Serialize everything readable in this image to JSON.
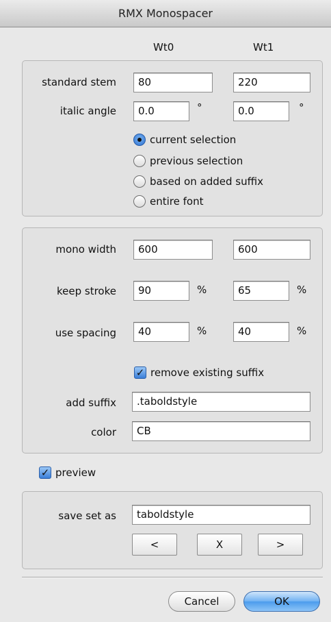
{
  "window": {
    "title": "RMX Monospacer"
  },
  "columns": {
    "wt0": "Wt0",
    "wt1": "Wt1"
  },
  "stem_group": {
    "standard_stem": {
      "label": "standard stem",
      "wt0": "80",
      "wt1": "220"
    },
    "italic_angle": {
      "label": "italic angle",
      "wt0": "0.0",
      "wt1": "0.0",
      "unit": "°"
    },
    "scope_options": [
      {
        "label": "current selection",
        "selected": true
      },
      {
        "label": "previous selection",
        "selected": false
      },
      {
        "label": "based on added suffix",
        "selected": false
      },
      {
        "label": "entire font",
        "selected": false
      }
    ]
  },
  "width_group": {
    "mono_width": {
      "label": "mono width",
      "wt0": "600",
      "wt1": "600"
    },
    "keep_stroke": {
      "label": "keep stroke",
      "wt0": "90",
      "wt1": "65",
      "unit": "%"
    },
    "use_spacing": {
      "label": "use spacing",
      "wt0": "40",
      "wt1": "40",
      "unit": "%"
    },
    "remove_suffix": {
      "label": "remove existing suffix",
      "checked": true
    },
    "add_suffix": {
      "label": "add suffix",
      "value": ".taboldstyle"
    },
    "color": {
      "label": "color",
      "value": "CB"
    }
  },
  "preview": {
    "label": "preview",
    "checked": true
  },
  "save_group": {
    "label": "save set as",
    "value": "taboldstyle",
    "prev_label": "<",
    "clear_label": "X",
    "next_label": ">"
  },
  "buttons": {
    "cancel": "Cancel",
    "ok": "OK"
  },
  "icons": {
    "checkmark": "check-icon",
    "radio": "radio-button"
  },
  "colors": {
    "accent": "#3a7ed8",
    "window_bg": "#e8e8e8"
  }
}
